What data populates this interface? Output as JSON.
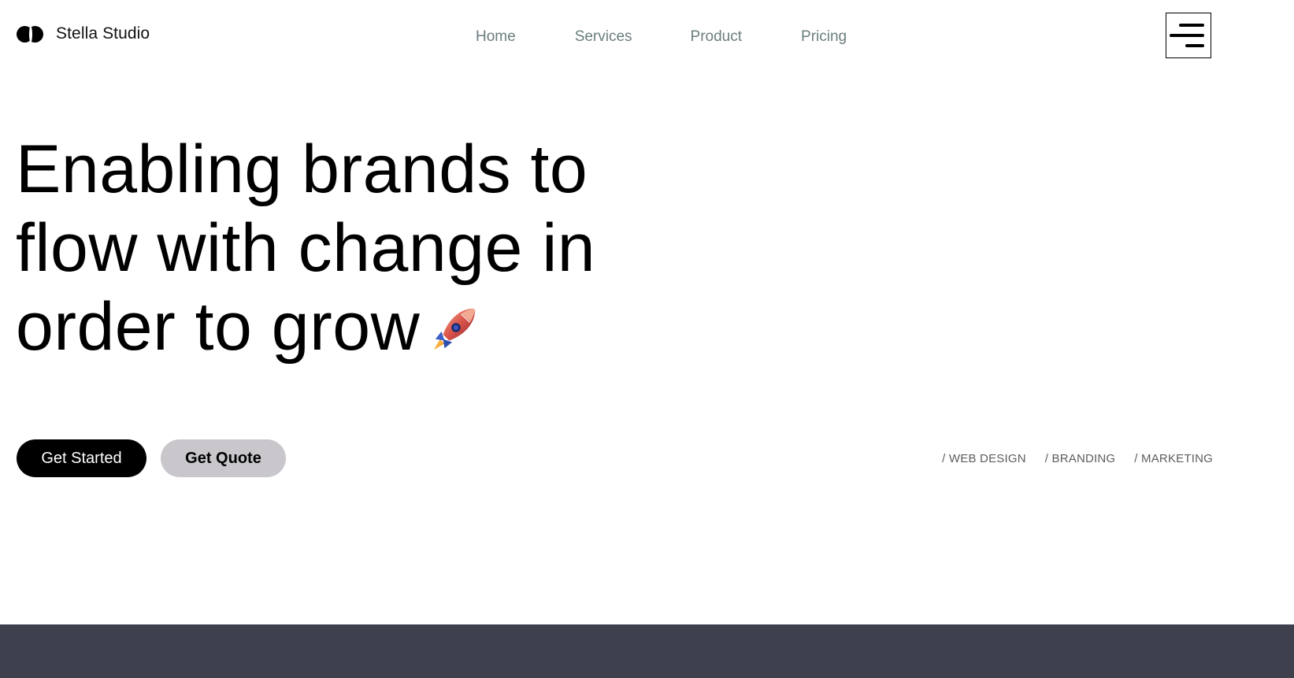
{
  "brand": {
    "name": "Stella Studio",
    "logo_icon": "overlapping-circles-logo"
  },
  "nav": {
    "items": [
      {
        "label": "Home"
      },
      {
        "label": "Services"
      },
      {
        "label": "Product"
      },
      {
        "label": "Pricing"
      }
    ],
    "menu_icon": "hamburger-menu-icon"
  },
  "hero": {
    "lines": [
      "Enabling brands to",
      "flow with change in",
      "order to grow"
    ],
    "emoji_icon": "rocket-icon"
  },
  "cta": {
    "primary_label": "Get Started",
    "secondary_label": "Get Quote"
  },
  "tags": [
    "/ WEB DESIGN",
    "/ BRANDING",
    "/ MARKETING"
  ],
  "colors": {
    "nav_text": "#6b7d7e",
    "primary_button": "#000000",
    "secondary_button": "#c9c7cc",
    "dark_band": "#3e404e"
  }
}
